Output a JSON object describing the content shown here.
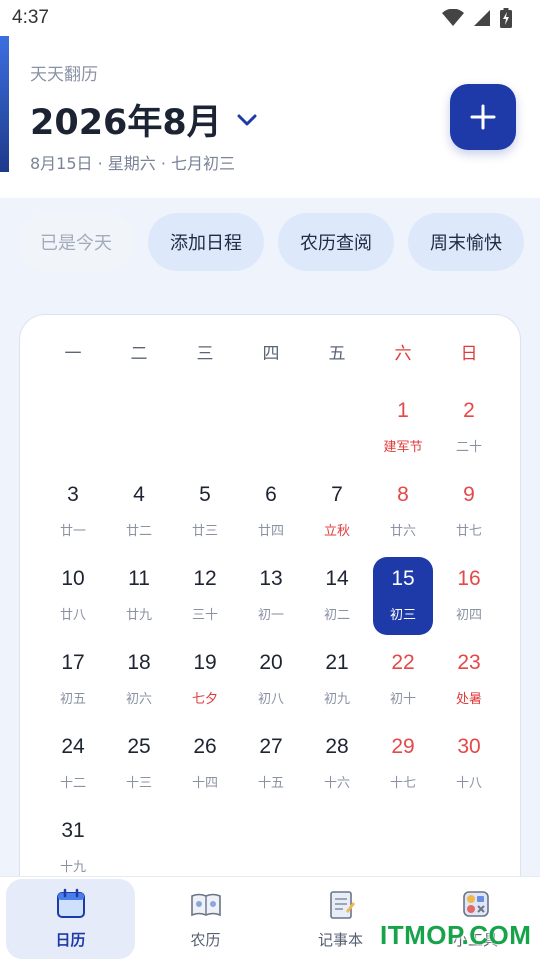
{
  "status_bar": {
    "time": "4:37"
  },
  "header": {
    "app_name": "天天翻历",
    "month_title": "2026年8月",
    "date_line": "8月15日 · 星期六 · 七月初三"
  },
  "chips": [
    {
      "label": "已是今天",
      "disabled": true
    },
    {
      "label": "添加日程"
    },
    {
      "label": "农历查阅"
    },
    {
      "label": "周末愉快"
    }
  ],
  "calendar": {
    "weekdays": [
      "一",
      "二",
      "三",
      "四",
      "五",
      "六",
      "日"
    ],
    "leading_blanks": 5,
    "selected_day": 15,
    "days": [
      {
        "day": "1",
        "sub": "建军节",
        "festival": true
      },
      {
        "day": "2",
        "sub": "二十"
      },
      {
        "day": "3",
        "sub": "廿一"
      },
      {
        "day": "4",
        "sub": "廿二"
      },
      {
        "day": "5",
        "sub": "廿三"
      },
      {
        "day": "6",
        "sub": "廿四"
      },
      {
        "day": "7",
        "sub": "立秋",
        "festival": true
      },
      {
        "day": "8",
        "sub": "廿六"
      },
      {
        "day": "9",
        "sub": "廿七"
      },
      {
        "day": "10",
        "sub": "廿八"
      },
      {
        "day": "11",
        "sub": "廿九"
      },
      {
        "day": "12",
        "sub": "三十"
      },
      {
        "day": "13",
        "sub": "初一"
      },
      {
        "day": "14",
        "sub": "初二"
      },
      {
        "day": "15",
        "sub": "初三"
      },
      {
        "day": "16",
        "sub": "初四"
      },
      {
        "day": "17",
        "sub": "初五"
      },
      {
        "day": "18",
        "sub": "初六"
      },
      {
        "day": "19",
        "sub": "七夕",
        "festival": true
      },
      {
        "day": "20",
        "sub": "初八"
      },
      {
        "day": "21",
        "sub": "初九"
      },
      {
        "day": "22",
        "sub": "初十"
      },
      {
        "day": "23",
        "sub": "处暑",
        "festival": true
      },
      {
        "day": "24",
        "sub": "十二"
      },
      {
        "day": "25",
        "sub": "十三"
      },
      {
        "day": "26",
        "sub": "十四"
      },
      {
        "day": "27",
        "sub": "十五"
      },
      {
        "day": "28",
        "sub": "十六"
      },
      {
        "day": "29",
        "sub": "十七"
      },
      {
        "day": "30",
        "sub": "十八"
      },
      {
        "day": "31",
        "sub": "十九"
      }
    ]
  },
  "bottom_nav": [
    {
      "label": "日历",
      "icon": "calendar-icon",
      "active": true
    },
    {
      "label": "农历",
      "icon": "almanac-book-icon"
    },
    {
      "label": "记事本",
      "icon": "notebook-icon"
    },
    {
      "label": "小工具",
      "icon": "toolbox-icon"
    }
  ],
  "watermark": "ITMOP.COM",
  "colors": {
    "accent": "#1e3aa8",
    "weekend": "#e44848",
    "background": "#eef3fc"
  }
}
